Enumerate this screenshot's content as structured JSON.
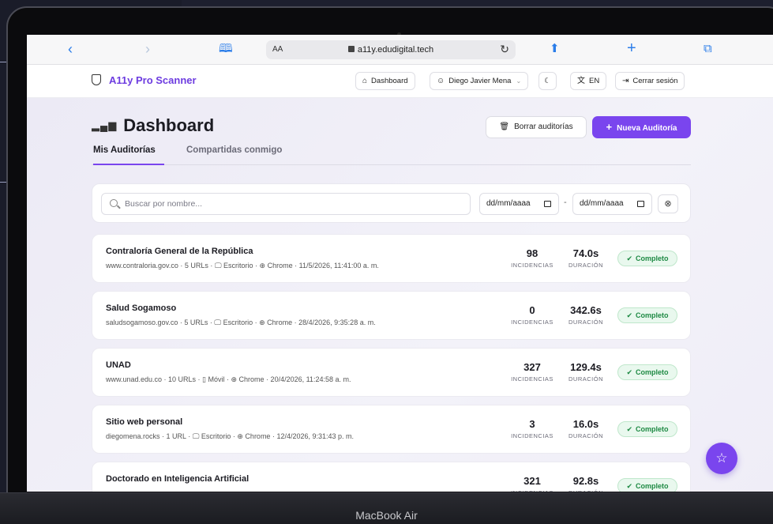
{
  "device": {
    "label": "MacBook Air"
  },
  "browser": {
    "aa_label": "AA",
    "url": "a11y.edudigital.tech",
    "icons": [
      "back-icon",
      "forward-icon",
      "bookmarks-icon",
      "reload-icon",
      "share-icon",
      "new-tab-icon",
      "tabs-icon"
    ]
  },
  "header": {
    "brand": "A11y Pro Scanner",
    "dashboard_label": "Dashboard",
    "user_label": "Diego Javier Mena",
    "lang_label": "EN",
    "logout_label": "Cerrar sesión"
  },
  "page": {
    "title": "Dashboard",
    "clear_label": "Borrar auditorías",
    "new_label": "Nueva Auditoría",
    "tabs": [
      {
        "label": "Mis Auditorías"
      },
      {
        "label": "Compartidas conmigo"
      }
    ]
  },
  "filters": {
    "search_placeholder": "Buscar por nombre...",
    "date_from": "dd/mm/aaaa",
    "date_to": "dd/mm/aaaa",
    "separator": "-"
  },
  "labels": {
    "issues": "INCIDENCIAS",
    "duration": "DURACIÓN"
  },
  "audits": [
    {
      "name": "Contraloría General de la República",
      "meta": "www.contraloria.gov.co · 5 URLs · 🖵 Escritorio · ⊕ Chrome · 11/5/2026, 11:41:00 a. m.",
      "issues": "98",
      "duration": "74.0s",
      "status": "Completo"
    },
    {
      "name": "Salud Sogamoso",
      "meta": "saludsogamoso.gov.co · 5 URLs · 🖵 Escritorio · ⊕ Chrome · 28/4/2026, 9:35:28 a. m.",
      "issues": "0",
      "duration": "342.6s",
      "status": "Completo"
    },
    {
      "name": "UNAD",
      "meta": "www.unad.edu.co · 10 URLs · ▯ Móvil · ⊕ Chrome · 20/4/2026, 11:24:58 a. m.",
      "issues": "327",
      "duration": "129.4s",
      "status": "Completo"
    },
    {
      "name": "Sitio web personal",
      "meta": "diegomena.rocks · 1 URL · 🖵 Escritorio · ⊕ Chrome · 12/4/2026, 9:31:43 p. m.",
      "issues": "3",
      "duration": "16.0s",
      "status": "Completo"
    },
    {
      "name": "Doctorado en Inteligencia Artificial",
      "meta": "",
      "issues": "321",
      "duration": "92.8s",
      "status": "Completo"
    }
  ],
  "colors": {
    "accent": "#7a45ee",
    "success": "#1e8a44"
  }
}
